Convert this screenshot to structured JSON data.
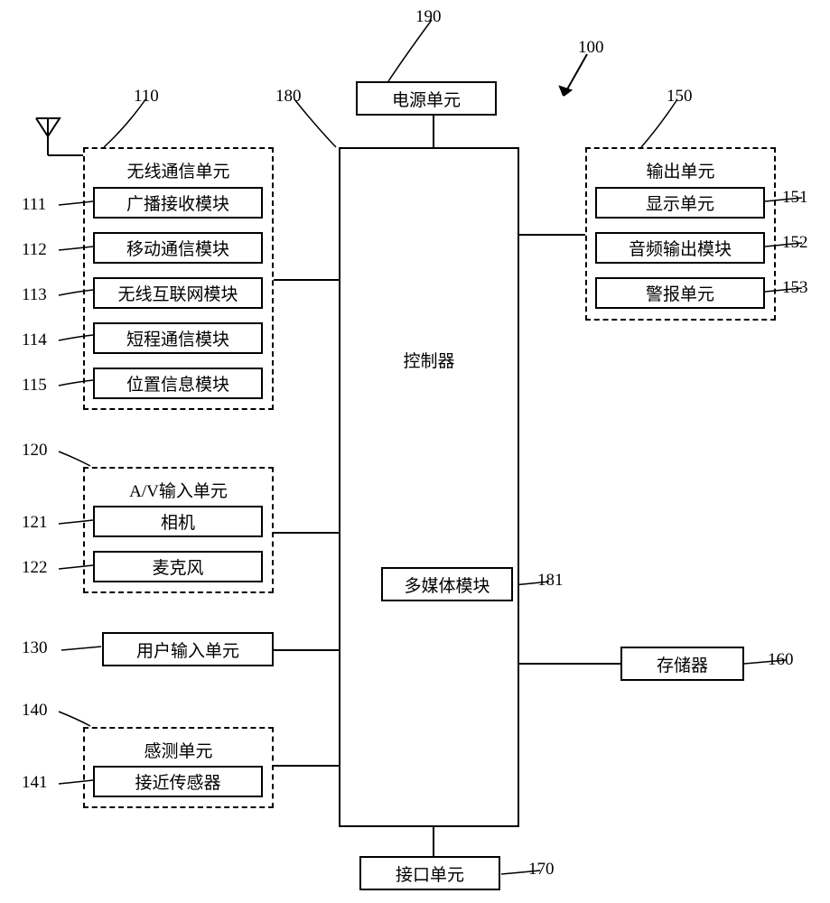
{
  "refs": {
    "r100": "100",
    "r110": "110",
    "r111": "111",
    "r112": "112",
    "r113": "113",
    "r114": "114",
    "r115": "115",
    "r120": "120",
    "r121": "121",
    "r122": "122",
    "r130": "130",
    "r140": "140",
    "r141": "141",
    "r150": "150",
    "r151": "151",
    "r152": "152",
    "r153": "153",
    "r160": "160",
    "r170": "170",
    "r180": "180",
    "r181": "181",
    "r190": "190"
  },
  "blocks": {
    "power": "电源单元",
    "controller": "控制器",
    "multimedia": "多媒体模块",
    "wireless_unit": "无线通信单元",
    "broadcast_rx": "广播接收模块",
    "mobile_comm": "移动通信模块",
    "wireless_internet": "无线互联网模块",
    "short_range": "短程通信模块",
    "location_info": "位置信息模块",
    "av_input_unit": "A/V输入单元",
    "camera": "相机",
    "microphone": "麦克风",
    "user_input": "用户输入单元",
    "sensing_unit": "感测单元",
    "proximity_sensor": "接近传感器",
    "output_unit": "输出单元",
    "display_unit": "显示单元",
    "audio_output": "音频输出模块",
    "alarm_unit": "警报单元",
    "memory": "存储器",
    "interface_unit": "接口单元"
  }
}
